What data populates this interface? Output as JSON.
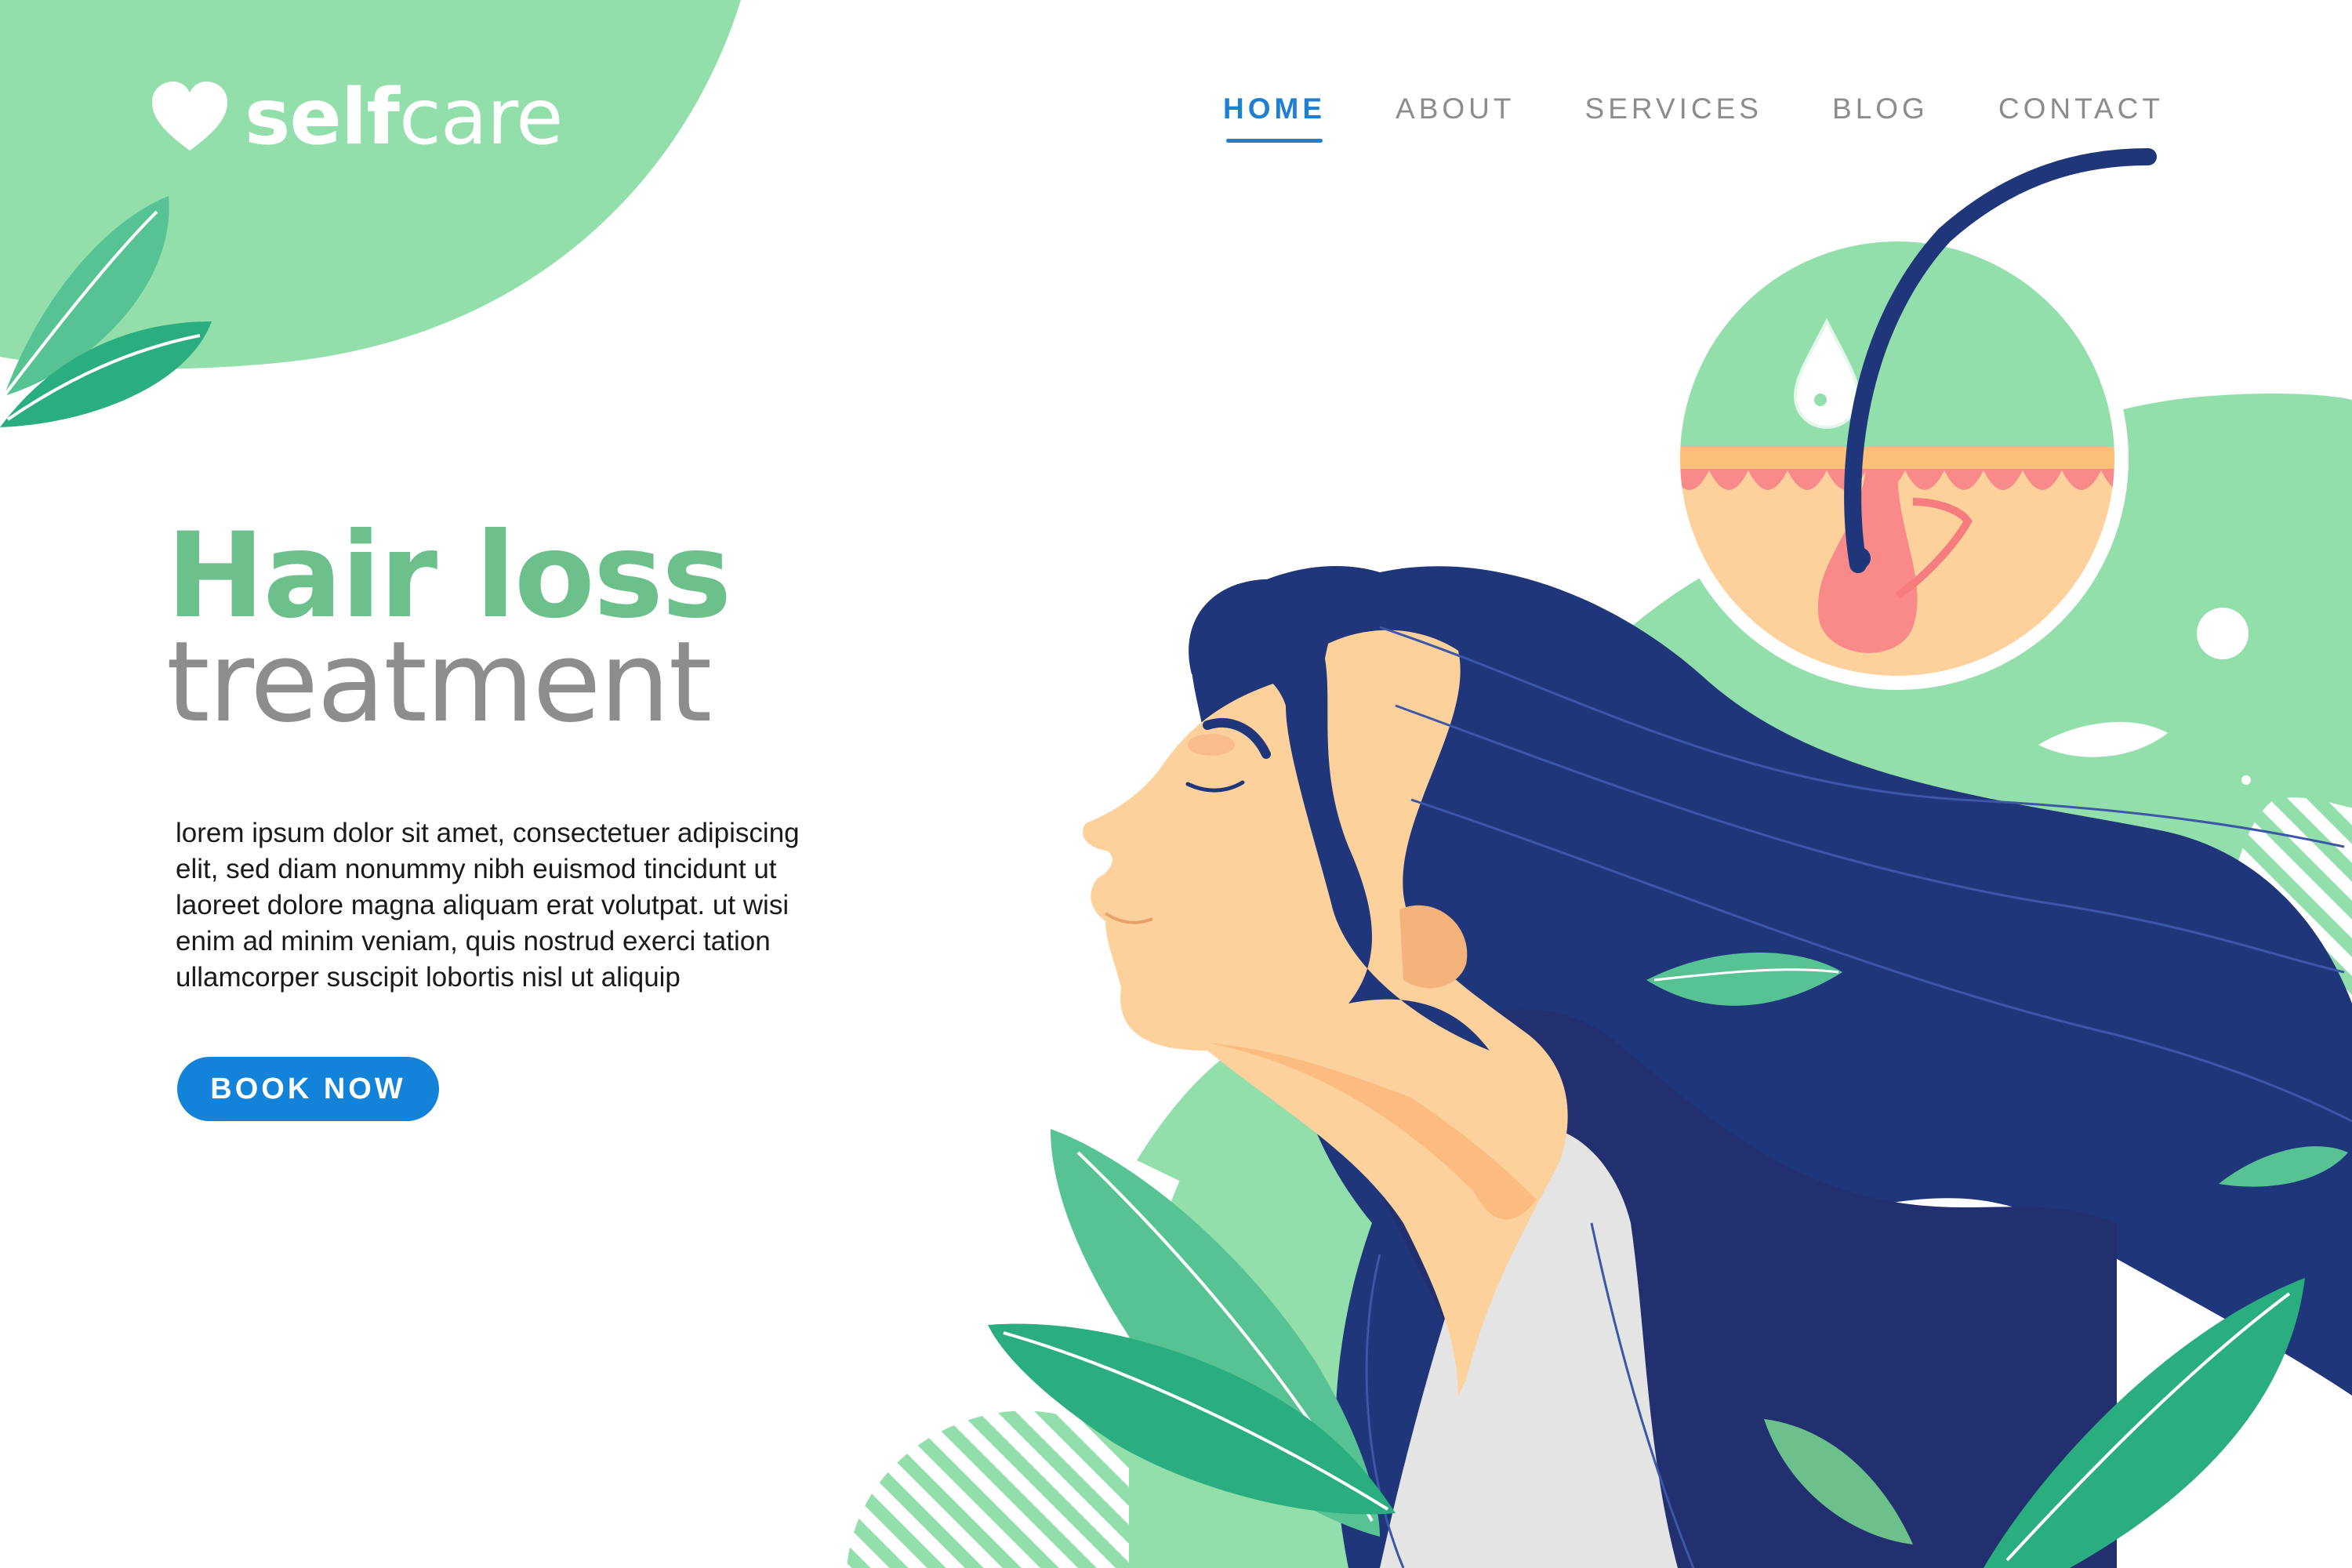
{
  "brand": {
    "name_bold": "self",
    "name_light": "care",
    "icon": "heart-icon"
  },
  "nav": {
    "items": [
      {
        "label": "HOME",
        "active": true
      },
      {
        "label": "ABOUT",
        "active": false
      },
      {
        "label": "SERVICES",
        "active": false
      },
      {
        "label": "BLOG",
        "active": false
      },
      {
        "label": "CONTACT",
        "active": false
      }
    ]
  },
  "hero": {
    "title_line1": "Hair loss",
    "title_line2": "treatment",
    "body_lines": [
      "lorem ipsum dolor sit amet, consectetuer adipiscing",
      "elit, sed diam nonummy nibh euismod tincidunt ut",
      "laoreet dolore magna aliquam erat volutpat. ut wisi",
      "enim ad minim veniam, quis nostrud exerci tation",
      "ullamcorper suscipit lobortis nisl ut aliquip"
    ],
    "cta_label": "BOOK NOW"
  },
  "colors": {
    "mint": "#92dfac",
    "green": "#6cc08b",
    "leaf": "#57c395",
    "leaf_dark": "#2aad7f",
    "navy": "#20367a",
    "skin": "#fdd19c",
    "accent_blue": "#1283d8",
    "gray_text": "#8d8d8d"
  }
}
